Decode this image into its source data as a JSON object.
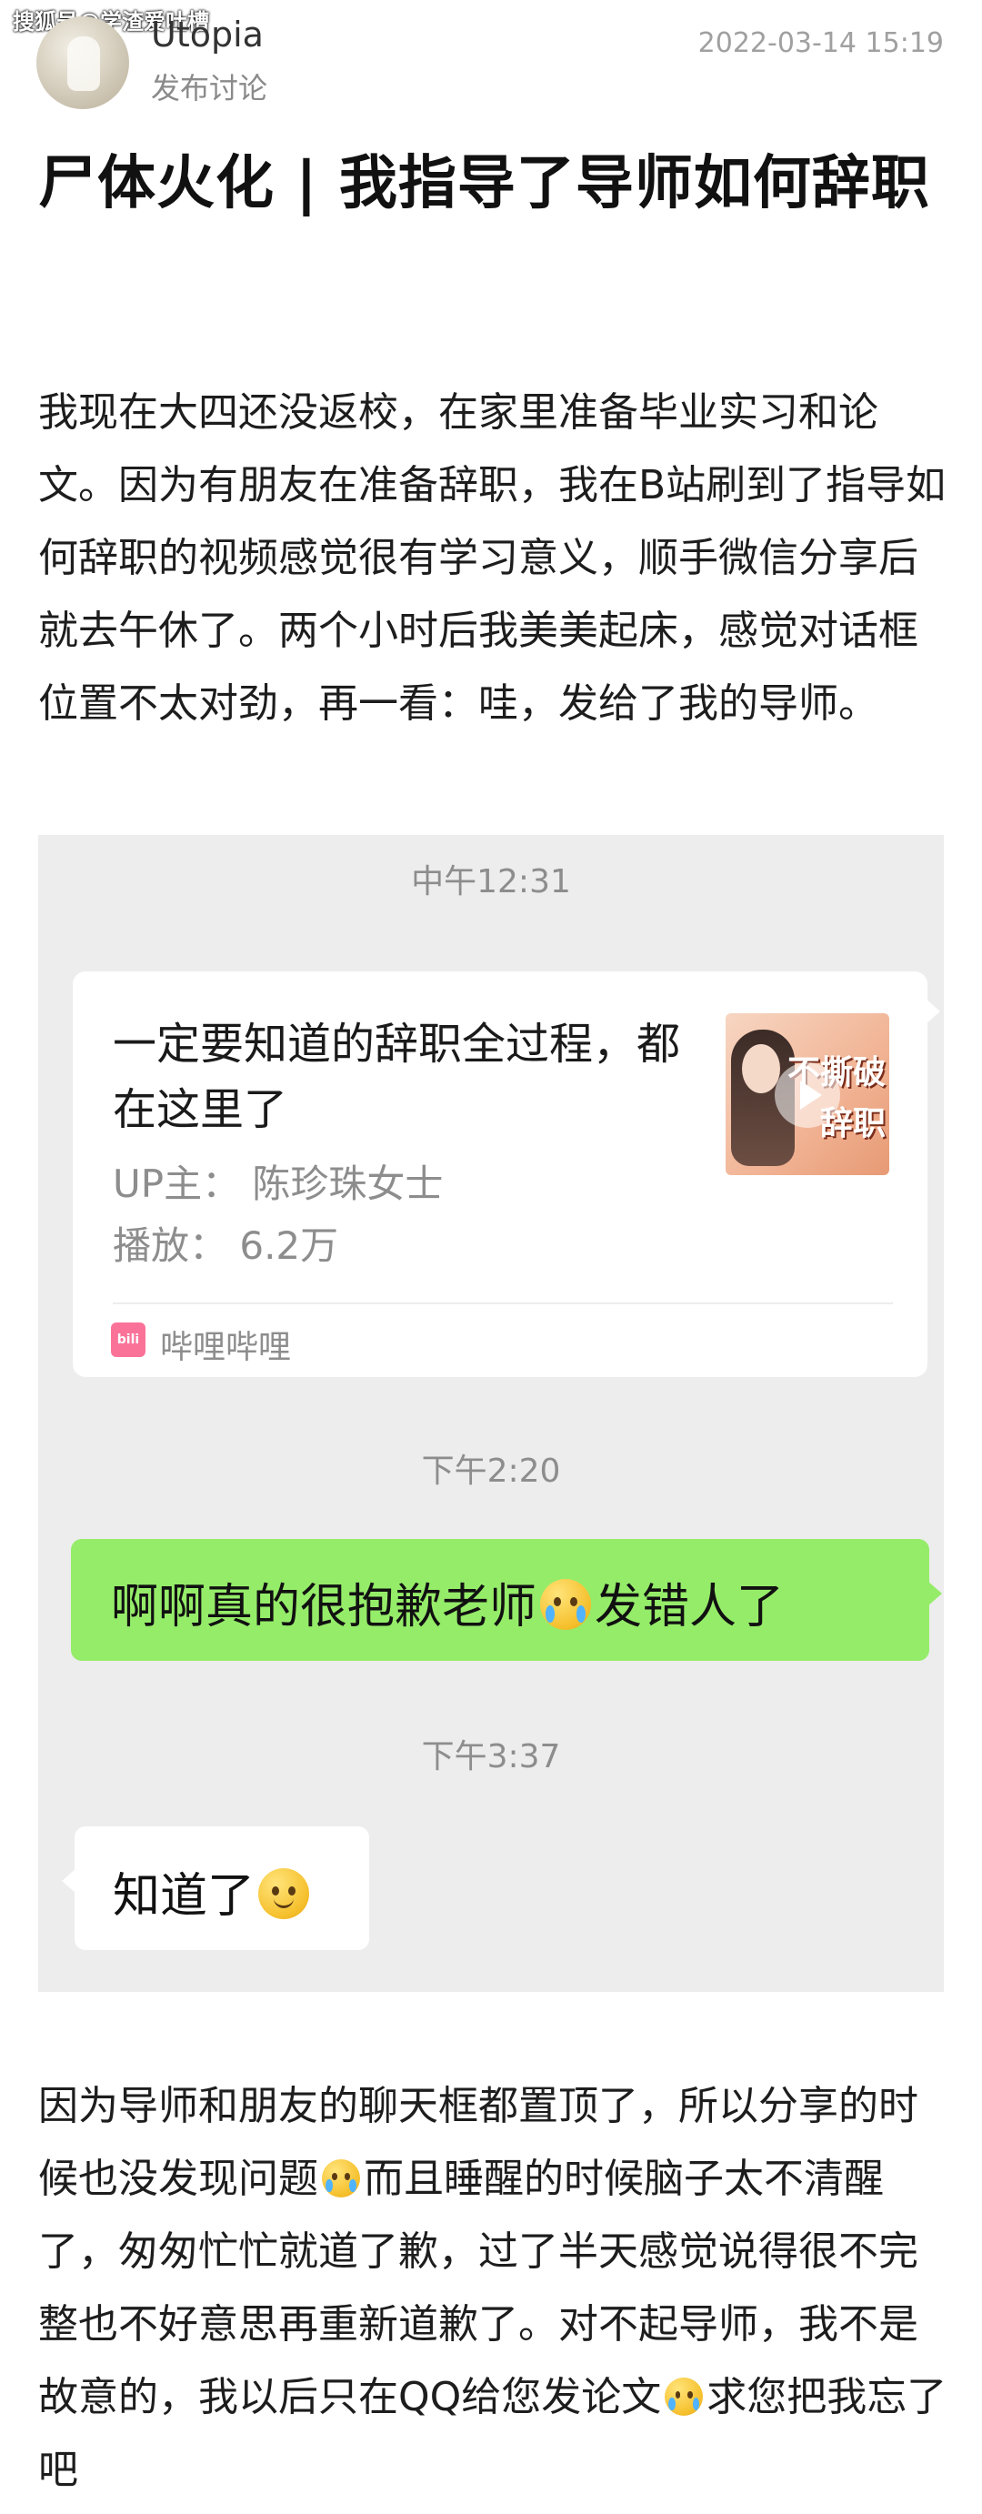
{
  "watermark": "搜狐号@学渣爱吐槽",
  "post": {
    "username": "Utopia",
    "subtitle": "发布讨论",
    "timestamp": "2022-03-14 15:19",
    "title": "尸体火化 | 我指导了导师如何辞职",
    "paragraph1": "我现在大四还没返校，在家里准备毕业实习和论文。因为有朋友在准备辞职，我在B站刷到了指导如何辞职的视频感觉很有学习意义，顺手微信分享后就去午休了。两个小时后我美美起床，感觉对话框位置不太对劲，再一看：哇，发给了我的导师。",
    "paragraph2_a": "因为导师和朋友的聊天框都置顶了，所以分享的时候也没发现问题",
    "paragraph2_b": "而且睡醒的时候脑子太不清醒了，匆匆忙忙就道了歉，过了半天感觉说得很不完整也不好意思再重新道歉了。对不起导师，我不是故意的，我以后只在QQ给您发论文",
    "paragraph2_c": "求您把我忘了吧"
  },
  "chat": {
    "time1": "中午12:31",
    "card": {
      "title": "一定要知道的辞职全过程，都在这里了",
      "uploader": "UP主：  陈珍珠女士",
      "plays": "播放：  6.2万",
      "thumb_text1": "不撕破",
      "thumb_text2": "辞职",
      "source_icon": "bilibili",
      "source": "哔哩哔哩"
    },
    "time2": "下午2:20",
    "msg_sent_a": "啊啊真的很抱歉老师",
    "msg_sent_b": "发错人了",
    "time3": "下午3:37",
    "msg_received": "知道了"
  }
}
